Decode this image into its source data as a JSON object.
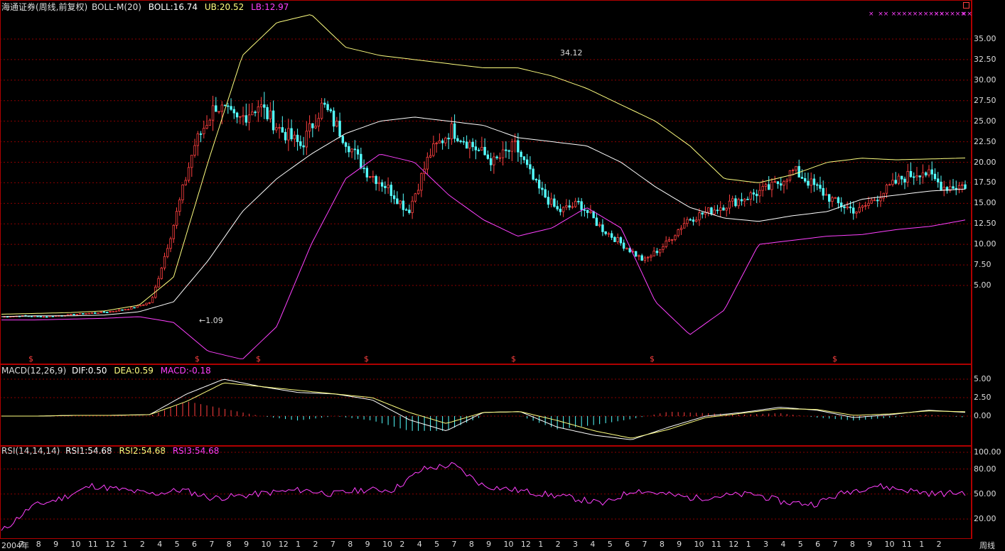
{
  "colors": {
    "up": "#ff4040",
    "down": "#54ffff",
    "yellow": "#ffff80",
    "white": "#ffffff",
    "magenta": "#ff40ff",
    "grid": "#8b0000",
    "frame": "#b00000",
    "label": "#dddddd"
  },
  "main": {
    "title": "海通证券(周线,前复权)",
    "indicator": "BOLL-M(20)",
    "boll": "BOLL:16.74",
    "ub": "UB:20.52",
    "lb": "LB:12.97",
    "high_label": "34.12",
    "low_label": "1.09",
    "ticks": [
      "35.00",
      "32.50",
      "30.00",
      "27.50",
      "25.00",
      "22.50",
      "20.00",
      "17.50",
      "15.00",
      "12.50",
      "10.00",
      "7.50",
      "5.00"
    ],
    "dividend_mark": "$",
    "top_marks": [
      "×",
      "××",
      "××××××××××",
      "××××××",
      "××"
    ]
  },
  "macd": {
    "title": "MACD(12,26,9)",
    "dif": "DIF:0.50",
    "dea": "DEA:0.59",
    "macd": "MACD:-0.18",
    "ticks": [
      "5.00",
      "2.50",
      "0.00"
    ]
  },
  "rsi": {
    "title": "RSI(14,14,14)",
    "rsi1": "RSI1:54.68",
    "rsi2": "RSI2:54.68",
    "rsi3": "RSI3:54.68",
    "ticks": [
      "100.00",
      "80.00",
      "50.00",
      "20.00"
    ]
  },
  "xaxis": {
    "labels": [
      "2004年",
      "7",
      "8",
      "9",
      "10",
      "11",
      "12",
      "1",
      "2",
      "4",
      "5",
      "6",
      "7",
      "8",
      "9",
      "10",
      "12",
      "1",
      "2",
      "7",
      "8",
      "9",
      "10",
      "2",
      "4",
      "5",
      "7",
      "8",
      "9",
      "10",
      "12",
      "1",
      "2",
      "3",
      "4",
      "5",
      "6",
      "7",
      "8",
      "9",
      "10",
      "11",
      "12",
      "1",
      "3",
      "4",
      "5",
      "6",
      "7",
      "8",
      "9",
      "10",
      "11",
      "1",
      "2"
    ],
    "period": "周线"
  },
  "chart_data": {
    "type": "candlestick",
    "series": [
      {
        "name": "BOLL",
        "values": [
          1.2,
          1.3,
          1.3,
          1.4,
          1.8,
          3,
          8,
          14,
          18,
          21,
          23.5,
          25,
          25.5,
          25,
          24.5,
          23,
          22.5,
          22,
          20,
          17,
          14.5,
          13.2,
          12.8,
          13.5,
          14,
          15.5,
          16,
          16.5,
          16.74
        ]
      },
      {
        "name": "UB",
        "values": [
          1.5,
          1.6,
          1.7,
          1.9,
          2.6,
          6,
          20,
          33,
          37,
          38,
          34,
          33,
          32.5,
          32,
          31.5,
          31.5,
          30.5,
          29,
          27,
          25,
          22,
          18,
          17.5,
          18.5,
          20,
          20.5,
          20.3,
          20.4,
          20.52
        ]
      },
      {
        "name": "LB",
        "values": [
          0.8,
          0.8,
          0.9,
          1,
          1.2,
          0.5,
          -3,
          -4,
          0,
          10,
          18,
          21,
          20,
          16,
          13,
          11,
          12,
          14.5,
          12,
          3,
          -1,
          2,
          10,
          10.5,
          11,
          11.2,
          11.8,
          12.2,
          12.97
        ]
      },
      {
        "name": "DIF",
        "values": [
          0,
          0,
          0.1,
          0.1,
          0.2,
          3,
          5,
          4,
          3.2,
          3,
          2.2,
          -0.5,
          -2,
          0.5,
          0.6,
          -1.5,
          -2.6,
          -3.2,
          -1.5,
          0,
          0.5,
          1.2,
          0.8,
          -0.2,
          0.2,
          0.8,
          0.5
        ]
      },
      {
        "name": "DEA",
        "values": [
          0,
          0,
          0.1,
          0.1,
          0.2,
          2,
          4.5,
          4,
          3.5,
          3,
          2.5,
          0.5,
          -1,
          0.5,
          0.6,
          -0.6,
          -2,
          -3,
          -1.8,
          -0.2,
          0.4,
          1,
          0.9,
          0.1,
          0.3,
          0.7,
          0.59
        ]
      },
      {
        "name": "RSI1",
        "values": [
          5,
          35,
          45,
          60,
          55,
          50,
          55,
          45,
          48,
          52,
          55,
          50,
          55,
          55,
          80,
          85,
          60,
          55,
          50,
          45,
          38,
          55,
          50,
          45,
          48,
          50,
          40,
          38,
          52,
          60,
          55,
          50,
          52
        ]
      }
    ],
    "ylim": [
      0,
      37
    ]
  }
}
